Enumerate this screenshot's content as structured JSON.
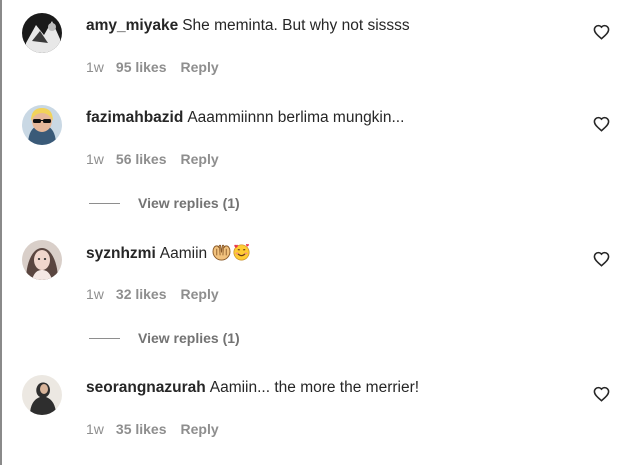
{
  "comments": [
    {
      "username": "amy_miyake",
      "text": "She meminta. But why not sissss",
      "time": "1w",
      "likes": "95 likes",
      "reply": "Reply",
      "view_replies": null
    },
    {
      "username": "fazimahbazid",
      "text": "Aaammiinnn berlima mungkin...",
      "time": "1w",
      "likes": "56 likes",
      "reply": "Reply",
      "view_replies": "View replies (1)"
    },
    {
      "username": "syznhzmi",
      "text": "Aamiin",
      "emojis": [
        "palms-up-together-emoji",
        "smiling-face-with-hearts-emoji"
      ],
      "time": "1w",
      "likes": "32 likes",
      "reply": "Reply",
      "view_replies": "View replies (1)"
    },
    {
      "username": "seorangnazurah",
      "text": "Aamiin... the more the merrier!",
      "time": "1w",
      "likes": "35 likes",
      "reply": "Reply",
      "view_replies": null
    }
  ],
  "colors": {
    "text": "#262626",
    "meta": "#8e8e8e",
    "background": "#ffffff"
  }
}
